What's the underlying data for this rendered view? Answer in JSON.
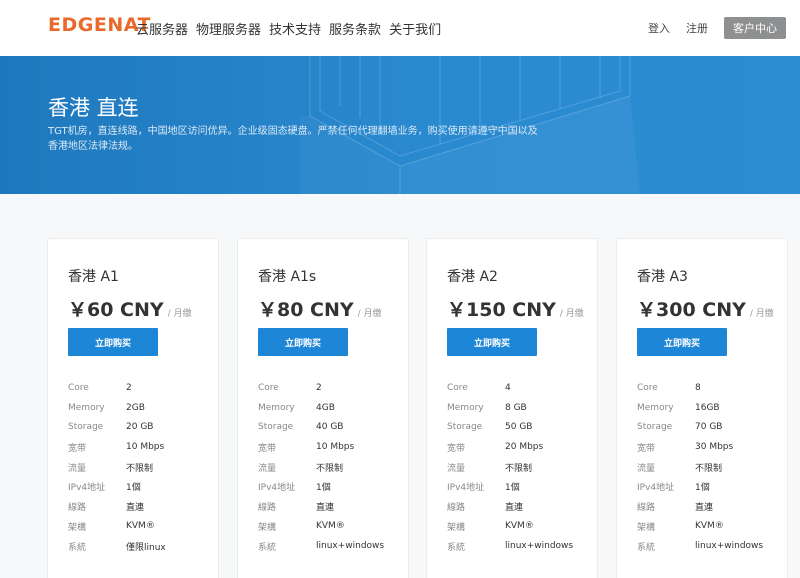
{
  "header": {
    "logo": "EDGENAT",
    "nav": [
      "云服务器",
      "物理服务器",
      "技术支持",
      "服务条款",
      "关于我们"
    ],
    "login": "登入",
    "register": "注册",
    "client_center": "客户中心"
  },
  "hero": {
    "title": "香港 直连",
    "description": "TGT机房，直连线路，中国地区访问优异。企业级固态硬盘。严禁任何代理翻墙业务，购买使用请遵守中国以及香港地区法律法规。"
  },
  "colors": {
    "accent": "#1e86d6",
    "logo": "#e8692a",
    "hero": "#2684c8"
  },
  "plans": [
    {
      "name": "香港 A1",
      "price": "￥60 CNY",
      "unit": "/ 月缴",
      "buy_label": "立即购买",
      "specs": [
        {
          "k": "Core",
          "v": "2"
        },
        {
          "k": "Memory",
          "v": "2GB"
        },
        {
          "k": "Storage",
          "v": "20 GB"
        },
        {
          "k": "宽带",
          "v": "10 Mbps"
        },
        {
          "k": "流量",
          "v": "不限制"
        },
        {
          "k": "IPv4地址",
          "v": "1個"
        },
        {
          "k": "線路",
          "v": "直連"
        },
        {
          "k": "架構",
          "v": "KVM®"
        },
        {
          "k": "系統",
          "v": "僅限linux"
        }
      ]
    },
    {
      "name": "香港 A1s",
      "price": "￥80 CNY",
      "unit": "/ 月缴",
      "buy_label": "立即购买",
      "specs": [
        {
          "k": "Core",
          "v": "2"
        },
        {
          "k": "Memory",
          "v": "4GB"
        },
        {
          "k": "Storage",
          "v": "40 GB"
        },
        {
          "k": "宽带",
          "v": "10 Mbps"
        },
        {
          "k": "流量",
          "v": "不限制"
        },
        {
          "k": "IPv4地址",
          "v": "1個"
        },
        {
          "k": "線路",
          "v": "直連"
        },
        {
          "k": "架構",
          "v": "KVM®"
        },
        {
          "k": "系統",
          "v": "linux+windows"
        }
      ]
    },
    {
      "name": "香港 A2",
      "price": "￥150 CNY",
      "unit": "/ 月缴",
      "buy_label": "立即购买",
      "specs": [
        {
          "k": "Core",
          "v": "4"
        },
        {
          "k": "Memory",
          "v": "8 GB"
        },
        {
          "k": "Storage",
          "v": "50 GB"
        },
        {
          "k": "宽带",
          "v": "20 Mbps"
        },
        {
          "k": "流量",
          "v": "不限制"
        },
        {
          "k": "IPv4地址",
          "v": "1個"
        },
        {
          "k": "線路",
          "v": "直連"
        },
        {
          "k": "架構",
          "v": "KVM®"
        },
        {
          "k": "系統",
          "v": "linux+windows"
        }
      ]
    },
    {
      "name": "香港 A3",
      "price": "￥300 CNY",
      "unit": "/ 月缴",
      "buy_label": "立即购买",
      "specs": [
        {
          "k": "Core",
          "v": "8"
        },
        {
          "k": "Memory",
          "v": "16GB"
        },
        {
          "k": "Storage",
          "v": "70 GB"
        },
        {
          "k": "宽带",
          "v": "30 Mbps"
        },
        {
          "k": "流量",
          "v": "不限制"
        },
        {
          "k": "IPv4地址",
          "v": "1個"
        },
        {
          "k": "線路",
          "v": "直連"
        },
        {
          "k": "架構",
          "v": "KVM®"
        },
        {
          "k": "系統",
          "v": "linux+windows"
        }
      ]
    }
  ]
}
